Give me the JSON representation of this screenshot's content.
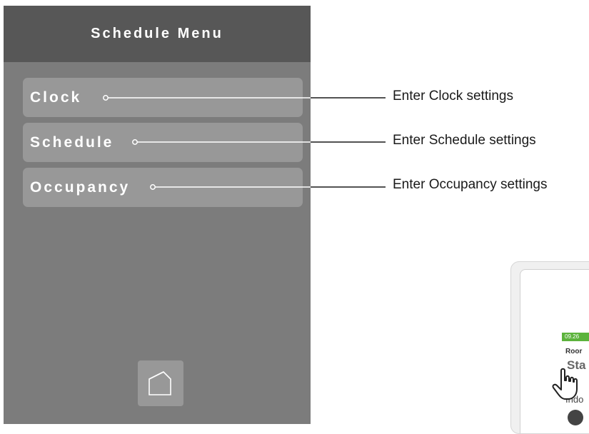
{
  "panel": {
    "title": "Schedule Menu",
    "items": [
      {
        "label": "Clock"
      },
      {
        "label": "Schedule"
      },
      {
        "label": "Occupancy"
      }
    ],
    "home_icon": "home-icon"
  },
  "callouts": [
    {
      "text": "Enter Clock settings"
    },
    {
      "text": "Enter Schedule settings"
    },
    {
      "text": "Enter Occupancy settings"
    }
  ],
  "device": {
    "time": "09.26",
    "room": "Roor",
    "status": "Sta",
    "indoor": "Indo",
    "pointer_icon": "hand-pointer-icon"
  },
  "colors": {
    "panel_bg": "#7c7c7c",
    "header_bg": "#575757",
    "item_bg": "#989898",
    "device_status_green": "#5cb33c"
  }
}
